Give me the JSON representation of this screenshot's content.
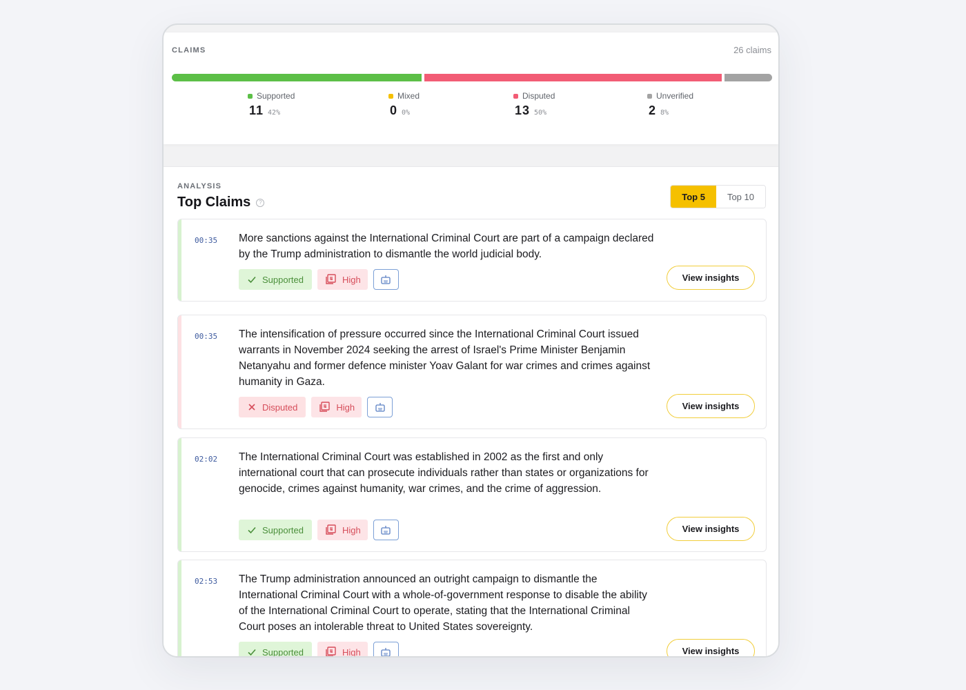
{
  "summary": {
    "label": "CLAIMS",
    "count_text": "26 claims",
    "colors": {
      "supported": "#5cbf47",
      "mixed": "#f5c000",
      "disputed": "#f25c75",
      "unverified": "#a3a3a3"
    },
    "distribution": {
      "supported": 0.42,
      "mixed": 0.0,
      "disputed": 0.5,
      "unverified": 0.08
    },
    "stats": [
      {
        "name": "Supported",
        "value": "11",
        "pct": "42%"
      },
      {
        "name": "Mixed",
        "value": "0",
        "pct": "0%"
      },
      {
        "name": "Disputed",
        "value": "13",
        "pct": "50%"
      },
      {
        "name": "Unverified",
        "value": "2",
        "pct": "8%"
      }
    ]
  },
  "analysis": {
    "label": "ANALYSIS",
    "title": "Top Claims",
    "help_icon": "question-circle-icon",
    "help_glyph": "?",
    "toggle": {
      "top5": "Top 5",
      "top10": "Top 10",
      "selected": "Top 5"
    },
    "claims": [
      {
        "time": "00:35",
        "text": "More sanctions against the International Criminal Court are part of a campaign declared by the Trump administration to dismantle the world judicial body.",
        "verdict": "Supported",
        "confidence": "High",
        "action": "View insights"
      },
      {
        "time": "00:35",
        "text": "The intensification of pressure occurred since the International Criminal Court issued warrants in November 2024 seeking the arrest of Israel's Prime Minister Benjamin Netanyahu and former defence minister Yoav Galant for war crimes and crimes against humanity in Gaza.",
        "verdict": "Disputed",
        "confidence": "High",
        "action": "View insights"
      },
      {
        "time": "02:02",
        "text": "The International Criminal Court was established in 2002 as the first and only international court that can prosecute individuals rather than states or organizations for genocide, crimes against humanity, war crimes, and the crime of aggression.",
        "verdict": "Supported",
        "confidence": "High",
        "action": "View insights"
      },
      {
        "time": "02:53",
        "text": "The Trump administration announced an outright campaign to dismantle the International Criminal Court with a whole-of-government response to disable the ability of the International Criminal Court to operate, stating that the International Criminal Court poses an intolerable threat to United States sovereignty.",
        "verdict": "Supported",
        "confidence": "High",
        "action": "View insights"
      }
    ]
  }
}
